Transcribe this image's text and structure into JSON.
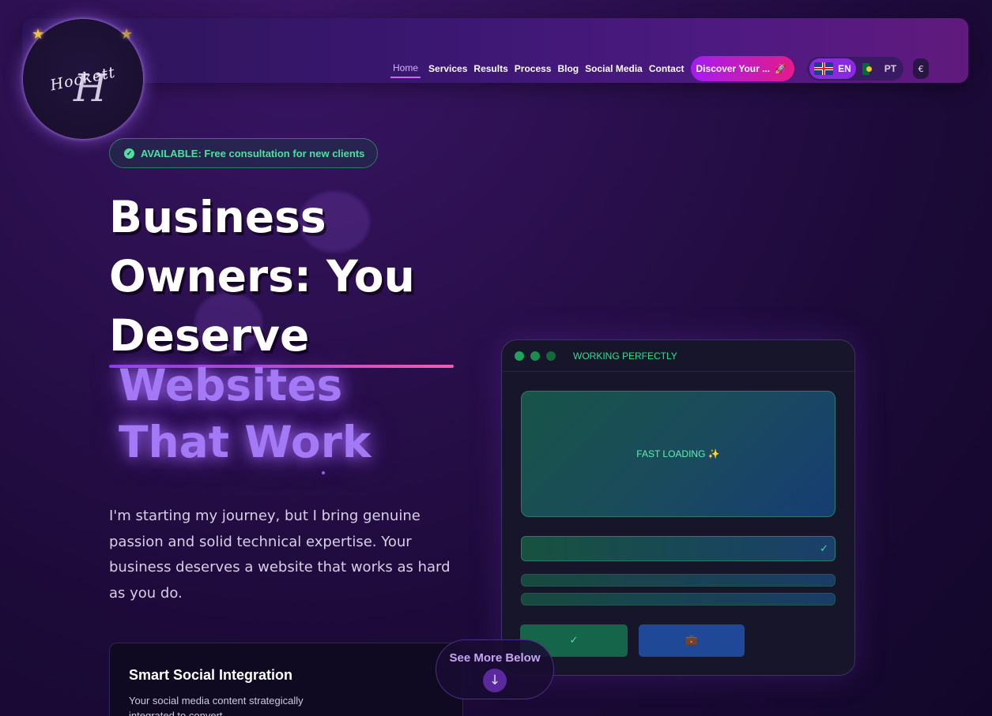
{
  "brand": {
    "logo_text": "Hockett",
    "logo_initial": "H"
  },
  "nav": {
    "links": [
      {
        "label": "Home",
        "active": true
      },
      {
        "label": "Services"
      },
      {
        "label": "Results"
      },
      {
        "label": "Process"
      },
      {
        "label": "Blog"
      },
      {
        "label": "Social Media"
      },
      {
        "label": "Contact"
      }
    ],
    "cta_label": "Discover Your ...",
    "languages": [
      {
        "code": "EN",
        "active": true
      },
      {
        "code": "PT"
      }
    ],
    "currency": "€"
  },
  "badge": {
    "text": "AVAILABLE: Free consultation for new clients"
  },
  "hero": {
    "headline_line1": "Business",
    "headline_line2": "Owners: You",
    "headline_line3": "Deserve",
    "highlight_line1": "Websites",
    "highlight_line2": "That Work",
    "lead": "I'm starting my journey, but I bring genuine passion and solid technical expertise. Your business deserves a website that works as hard as you do."
  },
  "feature_card": {
    "title": "Smart Social Integration",
    "text": "Your social media content strategically integrated to convert"
  },
  "see_more": {
    "label": "See More Below"
  },
  "mock_window": {
    "status": "WORKING PERFECTLY",
    "hero_text": "FAST LOADING ✨",
    "input_check": "✓",
    "button1": "✓",
    "button2": "💼"
  },
  "colors": {
    "accent_purple": "#a479f6",
    "accent_pink": "#e41b8a",
    "success_green": "#4ee0a0",
    "background": "#1c0a38"
  },
  "icons": [
    "star-icon",
    "check-circle-icon",
    "rocket-icon",
    "uk-flag-icon",
    "pt-flag-icon",
    "arrow-down-icon"
  ]
}
